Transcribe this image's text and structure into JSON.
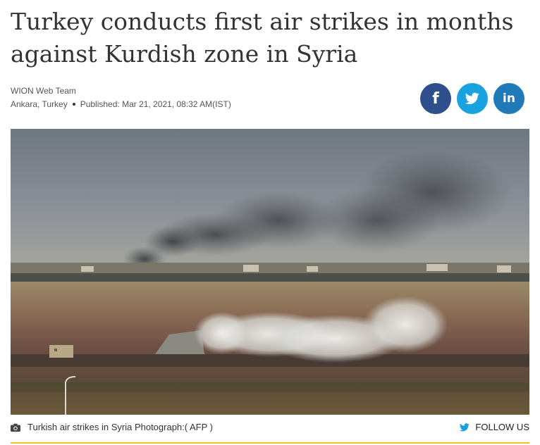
{
  "article": {
    "headline": "Turkey conducts first air strikes in months against Kurdish zone in Syria",
    "author": "WION Web Team",
    "location": "Ankara, Turkey",
    "published": "Published: Mar 21, 2021, 08:32 AM(IST)"
  },
  "share": {
    "facebook_glyph": "f",
    "twitter_icon": "twitter-bird-icon",
    "linkedin_glyph": "in",
    "colors": {
      "facebook": "#2e4e8c",
      "twitter": "#18a3e0",
      "linkedin": "#1f7ab7"
    }
  },
  "photo": {
    "caption": "Turkish air strikes in Syria Photograph:( AFP )"
  },
  "follow": {
    "label": "FOLLOW US",
    "icon": "twitter-bird-icon"
  },
  "accent_color": "#f0c419"
}
